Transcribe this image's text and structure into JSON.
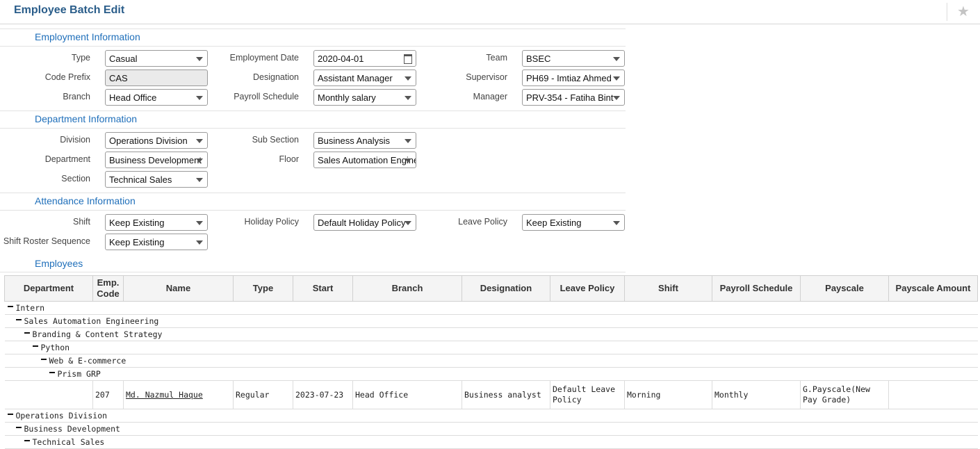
{
  "header": {
    "title": "Employee Batch Edit",
    "star_icon": "star-icon"
  },
  "sections": {
    "employment": "Employment Information",
    "department": "Department Information",
    "attendance": "Attendance Information",
    "employees": "Employees"
  },
  "employment": {
    "type": {
      "label": "Type",
      "value": "Casual"
    },
    "code_prefix": {
      "label": "Code Prefix",
      "value": "CAS"
    },
    "branch": {
      "label": "Branch",
      "value": "Head Office"
    },
    "employment_date": {
      "label": "Employment Date",
      "value": "2020-04-01"
    },
    "designation": {
      "label": "Designation",
      "value": "Assistant Manager"
    },
    "payroll_schedule": {
      "label": "Payroll Schedule",
      "value": "Monthly salary"
    },
    "team": {
      "label": "Team",
      "value": "BSEC"
    },
    "supervisor": {
      "label": "Supervisor",
      "value": "PH69 - Imtiaz Ahmed"
    },
    "manager": {
      "label": "Manager",
      "value": "PRV-354 - Fatiha Bint"
    }
  },
  "department": {
    "division": {
      "label": "Division",
      "value": "Operations Division"
    },
    "department": {
      "label": "Department",
      "value": "Business Development"
    },
    "section": {
      "label": "Section",
      "value": "Technical Sales"
    },
    "sub_section": {
      "label": "Sub Section",
      "value": "Business Analysis"
    },
    "floor": {
      "label": "Floor",
      "value": "Sales Automation Engineering"
    }
  },
  "attendance": {
    "shift": {
      "label": "Shift",
      "value": "Keep Existing"
    },
    "shift_roster": {
      "label": "Shift Roster Sequence",
      "value": "Keep Existing"
    },
    "holiday_policy": {
      "label": "Holiday Policy",
      "value": "Default Holiday Policy"
    },
    "leave_policy": {
      "label": "Leave Policy",
      "value": "Keep Existing"
    }
  },
  "table": {
    "columns": [
      "Department",
      "Emp. Code",
      "Name",
      "Type",
      "Start",
      "Branch",
      "Designation",
      "Leave Policy",
      "Shift",
      "Payroll Schedule",
      "Payscale",
      "Payscale Amount"
    ],
    "groups": [
      "Intern",
      "Sales Automation Engineering",
      "Branding & Content Strategy",
      "Python",
      "Web & E-commerce",
      "Prism GRP"
    ],
    "row": {
      "code": "207",
      "name": "Md. Nazmul Haque",
      "type": "Regular",
      "start": "2023-07-23",
      "branch": "Head Office",
      "designation": "Business analyst",
      "leave_policy": "Default Leave Policy",
      "shift": "Morning",
      "payroll": "Monthly",
      "payscale": "G.Payscale(New Pay Grade)",
      "payscale_amount": ""
    },
    "groups2": [
      "Operations Division",
      "Business Development",
      "Technical Sales"
    ]
  }
}
